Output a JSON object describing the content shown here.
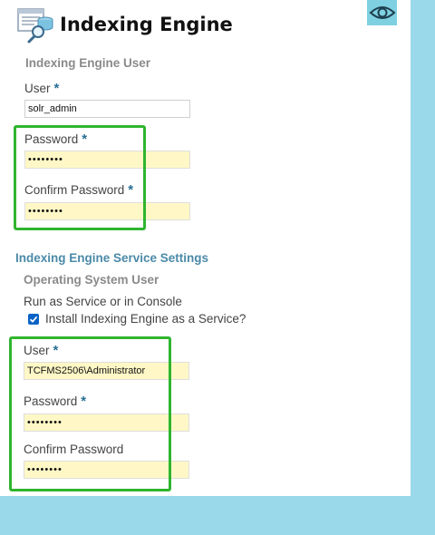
{
  "header": {
    "title": "Indexing Engine"
  },
  "icons": {
    "app": "database-search-icon",
    "eye": "eye-icon"
  },
  "engine_user": {
    "section_label": "Indexing Engine User",
    "user_label": "User",
    "user_value": "solr_admin",
    "password_label": "Password",
    "password_value": "••••••••",
    "confirm_label": "Confirm Password",
    "confirm_value": "••••••••",
    "required_mark": "*"
  },
  "service_settings": {
    "section_title": "Indexing Engine Service Settings",
    "os_user_label": "Operating System User",
    "run_mode_label": "Run as Service or in Console",
    "install_service_label": "Install Indexing Engine as a Service?",
    "install_service_checked": true,
    "user_label": "User",
    "user_value": "TCFMS2506\\Administrator",
    "password_label": "Password",
    "password_value": "••••••••",
    "confirm_label": "Confirm Password",
    "confirm_value": "••••••••",
    "required_mark": "*"
  },
  "colors": {
    "highlight": "#2fb52f",
    "page_background": "#9ad9e9",
    "section_heading": "#4b8aa8",
    "required_asterisk": "#2a6f94",
    "filled_input": "#fff8c6"
  }
}
